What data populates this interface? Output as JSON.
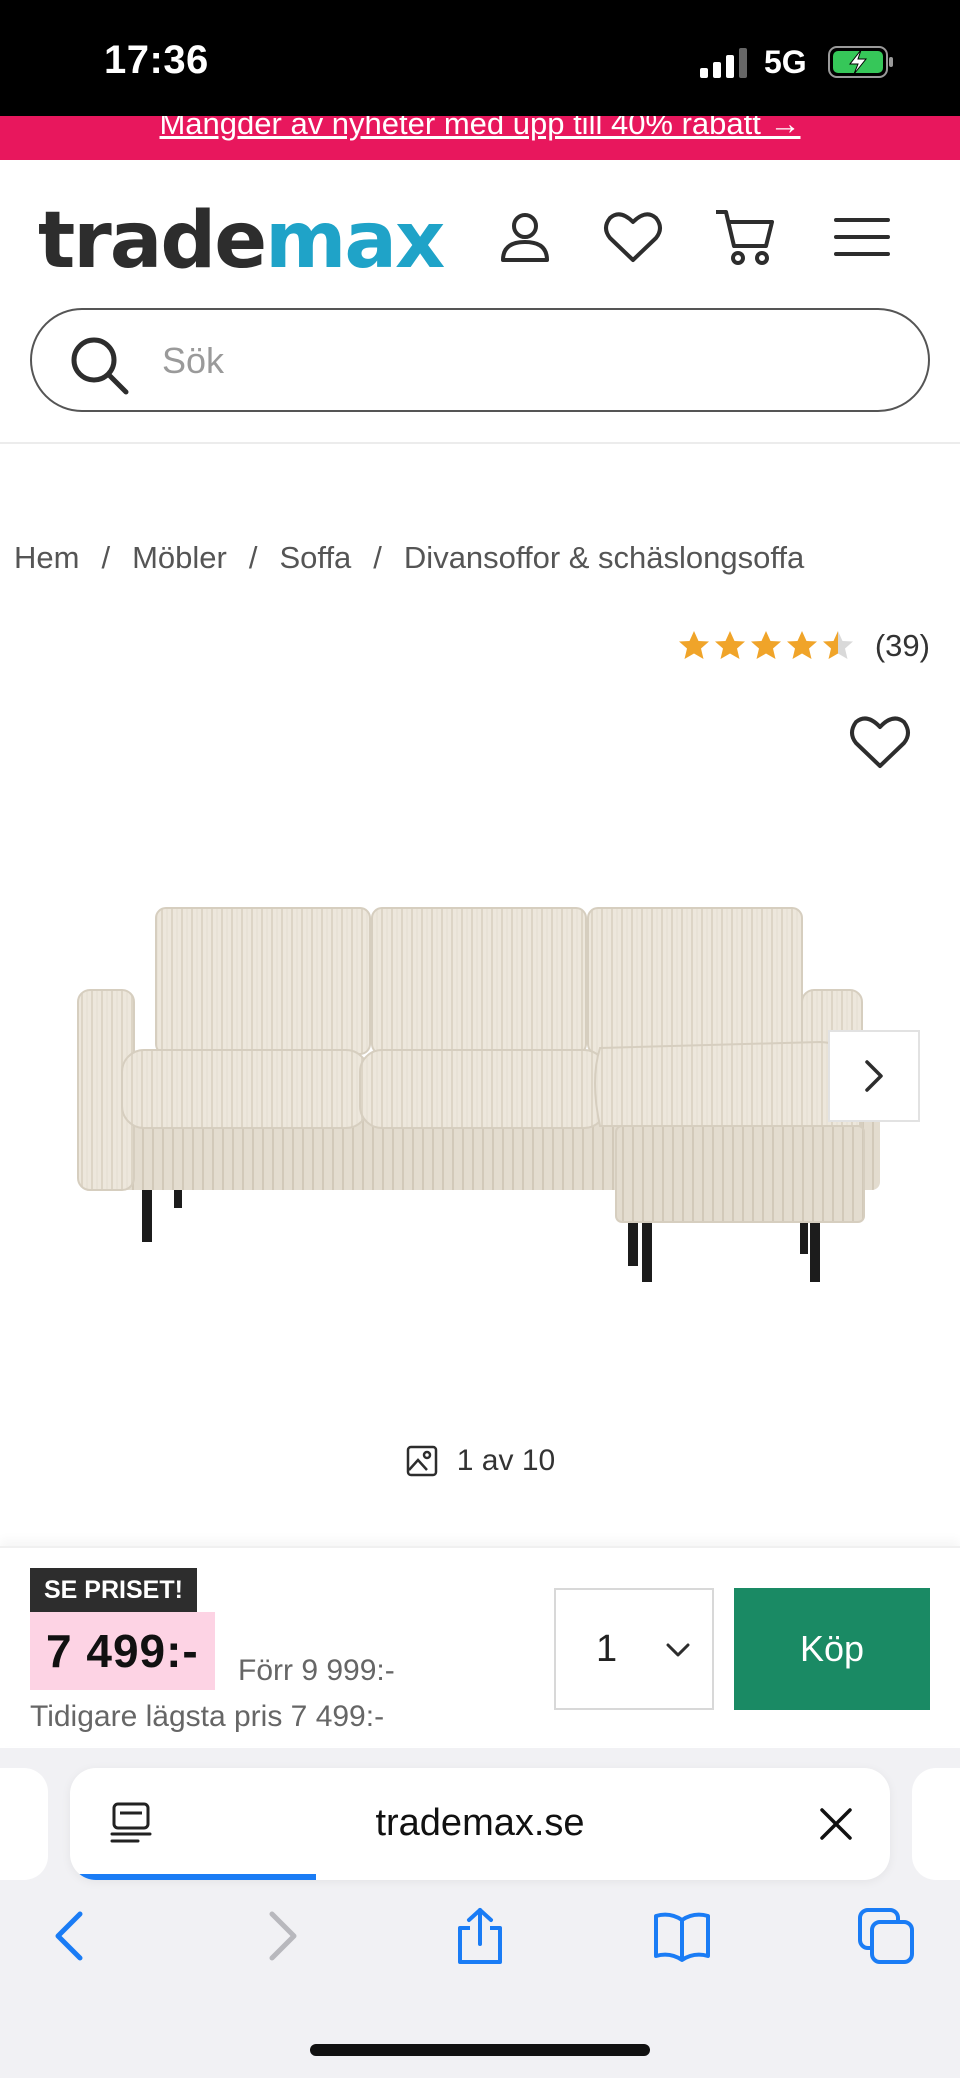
{
  "status": {
    "time": "17:36",
    "network": "5G",
    "battery_charging": true
  },
  "promo": {
    "text": "Mängder av nyheter med upp till 40% rabatt →"
  },
  "header": {
    "logo_part1": "trade",
    "logo_part2": "max",
    "icons": [
      "user-icon",
      "heart-icon",
      "cart-icon",
      "menu-icon"
    ],
    "search_placeholder": "Sök"
  },
  "breadcrumb": {
    "items": [
      "Hem",
      "Möbler",
      "Soffa",
      "Divansoffor & schäslongsoffa"
    ],
    "separator": "/"
  },
  "rating": {
    "stars": 4.5,
    "max": 5,
    "count_text": "(39)"
  },
  "gallery": {
    "counter_text": "1 av 10",
    "current": 1,
    "total": 10
  },
  "buy": {
    "badge": "SE PRISET!",
    "price": "7 499:-",
    "was": "Förr 9 999:-",
    "lowest": "Tidigare lägsta pris 7 499:-",
    "quantity": "1",
    "buy_label": "Köp"
  },
  "browser": {
    "url": "trademax.se",
    "load_progress": 0.3
  },
  "colors": {
    "promo": "#e8175d",
    "logo_accent": "#1fa3c8",
    "star": "#f0a429",
    "price_bg": "#fdd3e4",
    "buy_button": "#1a8a64",
    "ios_blue": "#1a7cf5"
  }
}
